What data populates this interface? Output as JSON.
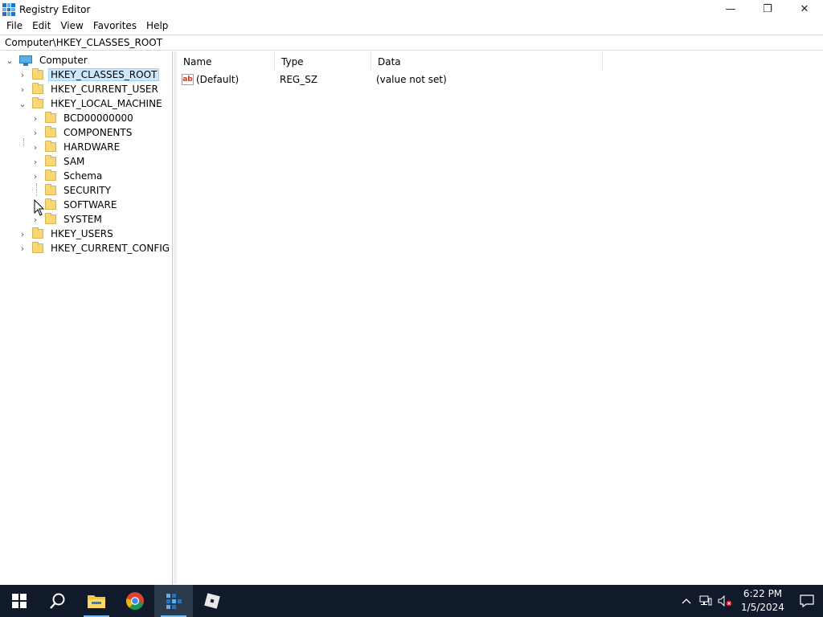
{
  "window": {
    "title": "Registry Editor",
    "minimize_glyph": "—",
    "maximize_glyph": "❐",
    "close_glyph": "✕"
  },
  "menu": {
    "items": [
      "File",
      "Edit",
      "View",
      "Favorites",
      "Help"
    ]
  },
  "address": {
    "path": "Computer\\HKEY_CLASSES_ROOT"
  },
  "tree": {
    "root": "Computer",
    "hkcr": "HKEY_CLASSES_ROOT",
    "hkcu": "HKEY_CURRENT_USER",
    "hklm": "HKEY_LOCAL_MACHINE",
    "hklm_children": [
      "BCD00000000",
      "COMPONENTS",
      "HARDWARE",
      "SAM",
      "Schema",
      "SECURITY",
      "SOFTWARE",
      "SYSTEM"
    ],
    "hku": "HKEY_USERS",
    "hkcc": "HKEY_CURRENT_CONFIG"
  },
  "list": {
    "columns": [
      "Name",
      "Type",
      "Data"
    ],
    "rows": [
      {
        "icon": "ab",
        "name": "(Default)",
        "type": "REG_SZ",
        "data": "(value not set)"
      }
    ]
  },
  "taskbar": {
    "pinned": [
      "start-icon",
      "search-icon",
      "file-explorer-icon",
      "chrome-icon",
      "registry-editor-icon",
      "roblox-icon"
    ],
    "tray": {
      "time": "6:22 PM",
      "date": "1/5/2024"
    }
  },
  "colors": {
    "selection": "#cce8ff",
    "taskbar": "#101a2a",
    "folder": "#f8d775"
  }
}
